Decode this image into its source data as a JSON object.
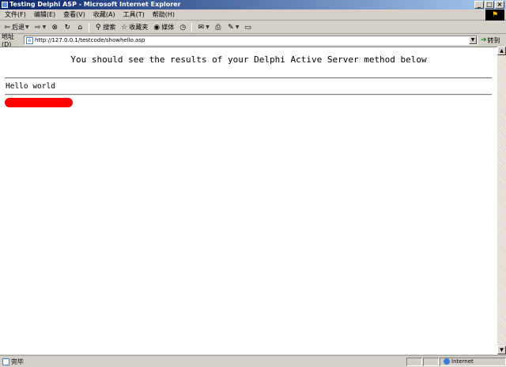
{
  "window": {
    "title": "Testing Delphi ASP - Microsoft Internet Explorer",
    "controls": {
      "minimize": "_",
      "maximize": "□",
      "close": "×"
    }
  },
  "menubar": {
    "items": [
      "文件(F)",
      "编辑(E)",
      "查看(V)",
      "收藏(A)",
      "工具(T)",
      "帮助(H)"
    ]
  },
  "toolbar": {
    "back_label": "后退",
    "search_label": "搜索",
    "favorites_label": "收藏夹",
    "media_label": "媒体"
  },
  "addressbar": {
    "label": "地址(D)",
    "url": "http://127.0.0.1/testcode/showhello.asp",
    "go_label": "转到"
  },
  "content": {
    "heading": "You should see the results of your Delphi Active Server method below",
    "message": "Hello world"
  },
  "statusbar": {
    "text": "完毕",
    "zone": "Internet"
  },
  "colors": {
    "redaction": "#ff0000",
    "title_gradient_start": "#0a246a"
  }
}
